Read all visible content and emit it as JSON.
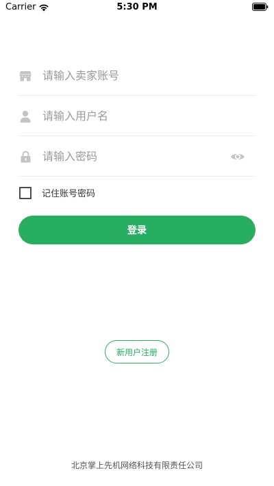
{
  "status_bar": {
    "carrier": "Carrier",
    "time": "5:30 PM"
  },
  "form": {
    "store_account": {
      "placeholder": "请输入卖家账号",
      "value": "",
      "icon": "store-icon"
    },
    "username": {
      "placeholder": "请输入用户名",
      "value": "",
      "icon": "user-icon"
    },
    "password": {
      "placeholder": "请输入密码",
      "value": "",
      "icon": "lock-icon",
      "toggle_icon": "eye-icon"
    },
    "remember": {
      "label": "记住账号密码",
      "checked": false
    },
    "login_label": "登录"
  },
  "register_label": "新用户注册",
  "footer": {
    "company": "北京掌上先机网络科技有限责任公司"
  },
  "colors": {
    "accent": "#27ae60",
    "icon_gray": "#c4c4c4"
  }
}
